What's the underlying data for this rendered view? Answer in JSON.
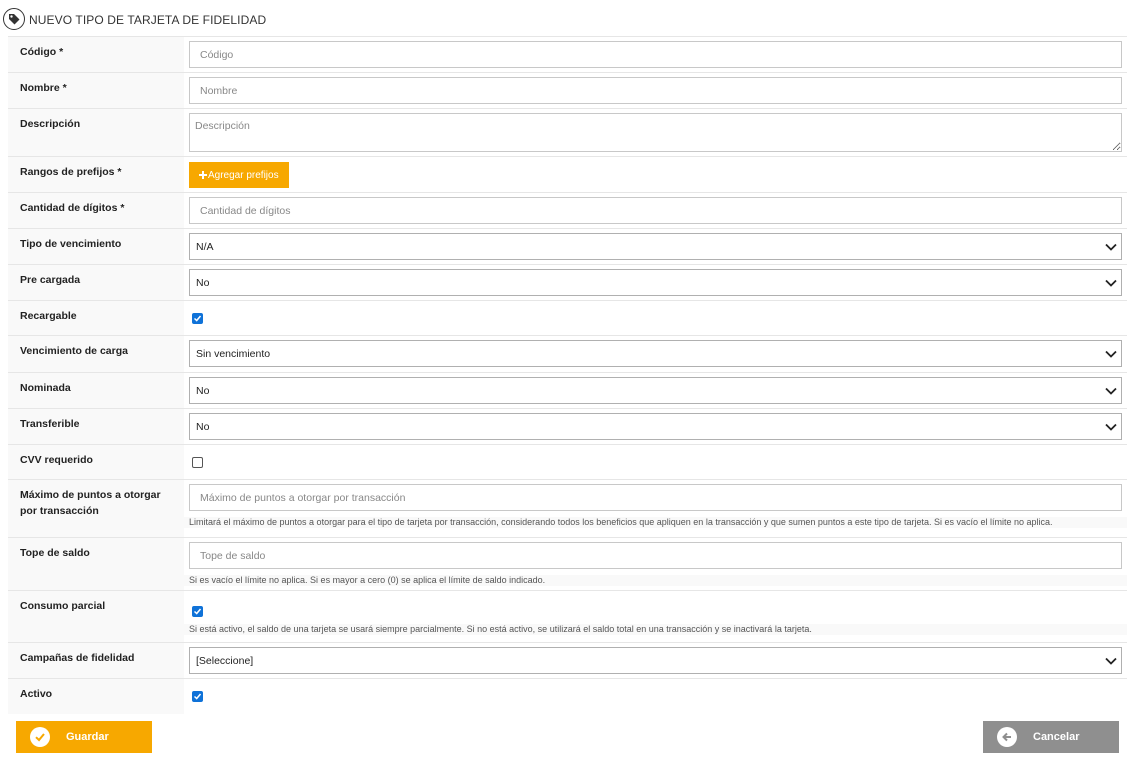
{
  "header": {
    "title": "NUEVO TIPO DE TARJETA DE FIDELIDAD"
  },
  "fields": {
    "codigo": {
      "label": "Código *",
      "placeholder": "Código"
    },
    "nombre": {
      "label": "Nombre *",
      "placeholder": "Nombre"
    },
    "descripcion": {
      "label": "Descripción",
      "placeholder": "Descripción"
    },
    "rangos": {
      "label": "Rangos de prefijos *",
      "button": "Agregar prefijos"
    },
    "digitos": {
      "label": "Cantidad de dígitos *",
      "placeholder": "Cantidad de dígitos"
    },
    "tipo_vencimiento": {
      "label": "Tipo de vencimiento",
      "value": "N/A"
    },
    "pre_cargada": {
      "label": "Pre cargada",
      "value": "No"
    },
    "recargable": {
      "label": "Recargable",
      "checked": true
    },
    "vencimiento_carga": {
      "label": "Vencimiento de carga",
      "value": "Sin vencimiento"
    },
    "nominada": {
      "label": "Nominada",
      "value": "No"
    },
    "transferible": {
      "label": "Transferible",
      "value": "No"
    },
    "cvv": {
      "label": "CVV requerido",
      "checked": false
    },
    "max_puntos": {
      "label": "Máximo de puntos a otorgar por transacción",
      "placeholder": "Máximo de puntos a otorgar por transacción",
      "help": "Limitará el máximo de puntos a otorgar para el tipo de tarjeta por transacción, considerando todos los beneficios que apliquen en la transacción y que sumen puntos a este tipo de tarjeta. Si es vacío el límite no aplica."
    },
    "tope_saldo": {
      "label": "Tope de saldo",
      "placeholder": "Tope de saldo",
      "help": "Si es vacío el límite no aplica. Si es mayor a cero (0) se aplica el límite de saldo indicado."
    },
    "consumo_parcial": {
      "label": "Consumo parcial",
      "checked": true,
      "help": "Si está activo, el saldo de una tarjeta se usará siempre parcialmente. Si no está activo, se utilizará el saldo total en una transacción y se inactivará la tarjeta."
    },
    "campanas": {
      "label": "Campañas de fidelidad",
      "value": "[Seleccione]"
    },
    "activo": {
      "label": "Activo",
      "checked": true
    }
  },
  "actions": {
    "save_label": "Guardar",
    "cancel_label": "Cancelar"
  },
  "colors": {
    "accent": "#f7a800",
    "checkbox": "#0f72d8",
    "cancel": "#8f8f8f"
  }
}
